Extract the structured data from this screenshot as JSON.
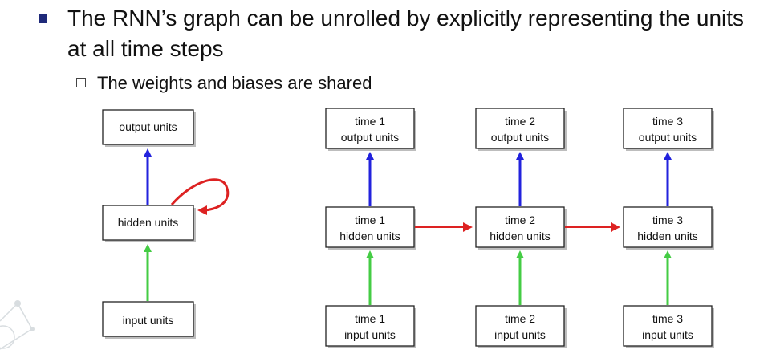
{
  "slide": {
    "bullet": "The RNN’s graph can be unrolled by explicitly representing the units at all time steps",
    "sub_bullet": "The weights and biases are shared"
  },
  "colors": {
    "bullet_square": "#1f2a7a",
    "hidden_to_output_arrow": "#2222dd",
    "input_to_hidden_arrow": "#44cc44",
    "recurrent_arrow": "#dd2222"
  },
  "folded": {
    "output": "output units",
    "hidden": "hidden units",
    "input": "input units"
  },
  "unrolled": [
    {
      "output_line1": "time 1",
      "output_line2": "output units",
      "hidden_line1": "time 1",
      "hidden_line2": "hidden units",
      "input_line1": "time 1",
      "input_line2": "input units"
    },
    {
      "output_line1": "time 2",
      "output_line2": "output units",
      "hidden_line1": "time 2",
      "hidden_line2": "hidden units",
      "input_line1": "time 2",
      "input_line2": "input units"
    },
    {
      "output_line1": "time 3",
      "output_line2": "output units",
      "hidden_line1": "time 3",
      "hidden_line2": "hidden units",
      "input_line1": "time 3",
      "input_line2": "input units"
    }
  ]
}
